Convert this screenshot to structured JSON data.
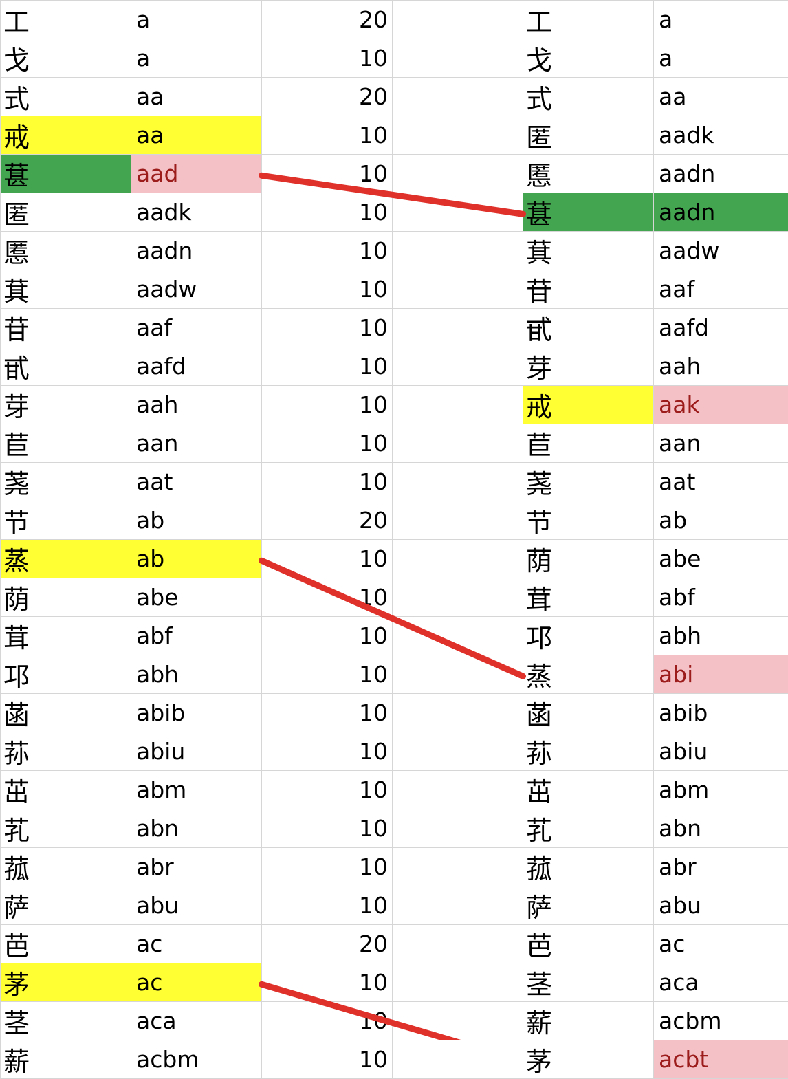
{
  "rows": [
    {
      "lc": "工",
      "lcode": "a",
      "count": "20",
      "rc": "工",
      "rcode": "a"
    },
    {
      "lc": "戈",
      "lcode": "a",
      "count": "10",
      "rc": "戈",
      "rcode": "a"
    },
    {
      "lc": "式",
      "lcode": "aa",
      "count": "20",
      "rc": "式",
      "rcode": "aa"
    },
    {
      "lc": "戒",
      "lcode": "aa",
      "count": "10",
      "rc": "匿",
      "rcode": "aadk",
      "l_hl": "yellow"
    },
    {
      "lc": "葚",
      "lcode": "aad",
      "count": "10",
      "rc": "慝",
      "rcode": "aadn",
      "l_hl": "green",
      "lcode_hl": "pink"
    },
    {
      "lc": "匿",
      "lcode": "aadk",
      "count": "10",
      "rc": "葚",
      "rcode": "aadn",
      "r_hl": "green"
    },
    {
      "lc": "慝",
      "lcode": "aadn",
      "count": "10",
      "rc": "萁",
      "rcode": "aadw"
    },
    {
      "lc": "萁",
      "lcode": "aadw",
      "count": "10",
      "rc": "苷",
      "rcode": "aaf"
    },
    {
      "lc": "苷",
      "lcode": "aaf",
      "count": "10",
      "rc": "甙",
      "rcode": "aafd"
    },
    {
      "lc": "甙",
      "lcode": "aafd",
      "count": "10",
      "rc": "芽",
      "rcode": "aah"
    },
    {
      "lc": "芽",
      "lcode": "aah",
      "count": "10",
      "rc": "戒",
      "rcode": "aak",
      "rc_hl": "yellow",
      "rcode_hl": "pink"
    },
    {
      "lc": "苣",
      "lcode": "aan",
      "count": "10",
      "rc": "苣",
      "rcode": "aan"
    },
    {
      "lc": "荛",
      "lcode": "aat",
      "count": "10",
      "rc": "荛",
      "rcode": "aat"
    },
    {
      "lc": "节",
      "lcode": "ab",
      "count": "20",
      "rc": "节",
      "rcode": "ab"
    },
    {
      "lc": "蒸",
      "lcode": "ab",
      "count": "10",
      "rc": "荫",
      "rcode": "abe",
      "l_hl": "yellow"
    },
    {
      "lc": "荫",
      "lcode": "abe",
      "count": "10",
      "rc": "茸",
      "rcode": "abf"
    },
    {
      "lc": "茸",
      "lcode": "abf",
      "count": "10",
      "rc": "邛",
      "rcode": "abh"
    },
    {
      "lc": "邛",
      "lcode": "abh",
      "count": "10",
      "rc": "蒸",
      "rcode": "abi",
      "rcode_hl": "pink"
    },
    {
      "lc": "菡",
      "lcode": "abib",
      "count": "10",
      "rc": "菡",
      "rcode": "abib"
    },
    {
      "lc": "荪",
      "lcode": "abiu",
      "count": "10",
      "rc": "荪",
      "rcode": "abiu"
    },
    {
      "lc": "茁",
      "lcode": "abm",
      "count": "10",
      "rc": "茁",
      "rcode": "abm"
    },
    {
      "lc": "芤",
      "lcode": "abn",
      "count": "10",
      "rc": "芤",
      "rcode": "abn"
    },
    {
      "lc": "菰",
      "lcode": "abr",
      "count": "10",
      "rc": "菰",
      "rcode": "abr"
    },
    {
      "lc": "萨",
      "lcode": "abu",
      "count": "10",
      "rc": "萨",
      "rcode": "abu"
    },
    {
      "lc": "芭",
      "lcode": "ac",
      "count": "20",
      "rc": "芭",
      "rcode": "ac"
    },
    {
      "lc": "茅",
      "lcode": "ac",
      "count": "10",
      "rc": "茎",
      "rcode": "aca",
      "l_hl": "yellow"
    },
    {
      "lc": "茎",
      "lcode": "aca",
      "count": "10",
      "rc": "薪",
      "rcode": "acbm"
    },
    {
      "lc": "薪",
      "lcode": "acbm",
      "count": "10",
      "rc": "茅",
      "rcode": "acbt",
      "rcode_hl": "pink"
    }
  ],
  "colors": {
    "yellow": "#ffff33",
    "green": "#43a54f",
    "pink": "#f4c2c6",
    "connector": "#e0302a"
  },
  "connectors": [
    {
      "from_row": 4,
      "to_row": 5
    },
    {
      "from_row": 14,
      "to_row": 17
    },
    {
      "from_row": 25,
      "to_row": 27
    }
  ]
}
